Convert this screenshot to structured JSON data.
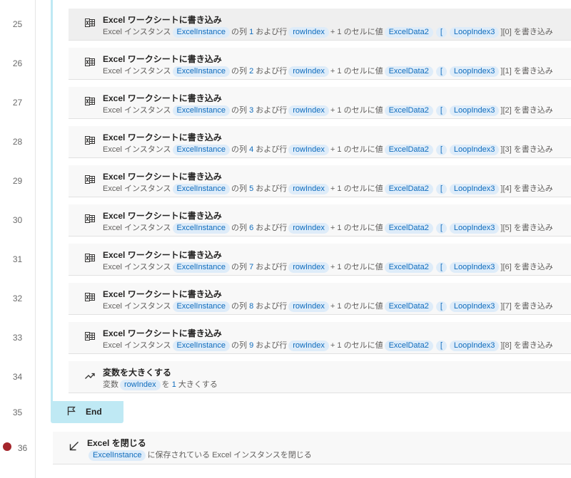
{
  "gutter": {
    "line_numbers": [
      "25",
      "26",
      "27",
      "28",
      "29",
      "30",
      "31",
      "32",
      "33",
      "34",
      "35",
      "36"
    ]
  },
  "actions": [
    {
      "title": "Excel ワークシートに書き込み",
      "p1": "Excel インスタンス",
      "var1": "ExcelInstance",
      "p2": "の列",
      "col": "1",
      "p3": "および行",
      "var2": "rowIndex",
      "p4": "+",
      "one": "1",
      "p5": "のセルに値",
      "var3": "ExcelData2",
      "bo": "[",
      "var4": "LoopIndex3",
      "bc": "][0]",
      "p6": "を書き込み"
    },
    {
      "title": "Excel ワークシートに書き込み",
      "p1": "Excel インスタンス",
      "var1": "ExcelInstance",
      "p2": "の列",
      "col": "2",
      "p3": "および行",
      "var2": "rowIndex",
      "p4": "+",
      "one": "1",
      "p5": "のセルに値",
      "var3": "ExcelData2",
      "bo": "[",
      "var4": "LoopIndex3",
      "bc": "][1]",
      "p6": "を書き込み"
    },
    {
      "title": "Excel ワークシートに書き込み",
      "p1": "Excel インスタンス",
      "var1": "ExcelInstance",
      "p2": "の列",
      "col": "3",
      "p3": "および行",
      "var2": "rowIndex",
      "p4": "+",
      "one": "1",
      "p5": "のセルに値",
      "var3": "ExcelData2",
      "bo": "[",
      "var4": "LoopIndex3",
      "bc": "][2]",
      "p6": "を書き込み"
    },
    {
      "title": "Excel ワークシートに書き込み",
      "p1": "Excel インスタンス",
      "var1": "ExcelInstance",
      "p2": "の列",
      "col": "4",
      "p3": "および行",
      "var2": "rowIndex",
      "p4": "+",
      "one": "1",
      "p5": "のセルに値",
      "var3": "ExcelData2",
      "bo": "[",
      "var4": "LoopIndex3",
      "bc": "][3]",
      "p6": "を書き込み"
    },
    {
      "title": "Excel ワークシートに書き込み",
      "p1": "Excel インスタンス",
      "var1": "ExcelInstance",
      "p2": "の列",
      "col": "5",
      "p3": "および行",
      "var2": "rowIndex",
      "p4": "+",
      "one": "1",
      "p5": "のセルに値",
      "var3": "ExcelData2",
      "bo": "[",
      "var4": "LoopIndex3",
      "bc": "][4]",
      "p6": "を書き込み"
    },
    {
      "title": "Excel ワークシートに書き込み",
      "p1": "Excel インスタンス",
      "var1": "ExcelInstance",
      "p2": "の列",
      "col": "6",
      "p3": "および行",
      "var2": "rowIndex",
      "p4": "+",
      "one": "1",
      "p5": "のセルに値",
      "var3": "ExcelData2",
      "bo": "[",
      "var4": "LoopIndex3",
      "bc": "][5]",
      "p6": "を書き込み"
    },
    {
      "title": "Excel ワークシートに書き込み",
      "p1": "Excel インスタンス",
      "var1": "ExcelInstance",
      "p2": "の列",
      "col": "7",
      "p3": "および行",
      "var2": "rowIndex",
      "p4": "+",
      "one": "1",
      "p5": "のセルに値",
      "var3": "ExcelData2",
      "bo": "[",
      "var4": "LoopIndex3",
      "bc": "][6]",
      "p6": "を書き込み"
    },
    {
      "title": "Excel ワークシートに書き込み",
      "p1": "Excel インスタンス",
      "var1": "ExcelInstance",
      "p2": "の列",
      "col": "8",
      "p3": "および行",
      "var2": "rowIndex",
      "p4": "+",
      "one": "1",
      "p5": "のセルに値",
      "var3": "ExcelData2",
      "bo": "[",
      "var4": "LoopIndex3",
      "bc": "][7]",
      "p6": "を書き込み"
    },
    {
      "title": "Excel ワークシートに書き込み",
      "p1": "Excel インスタンス",
      "var1": "ExcelInstance",
      "p2": "の列",
      "col": "9",
      "p3": "および行",
      "var2": "rowIndex",
      "p4": "+",
      "one": "1",
      "p5": "のセルに値",
      "var3": "ExcelData2",
      "bo": "[",
      "var4": "LoopIndex3",
      "bc": "][8]",
      "p6": "を書き込み"
    }
  ],
  "increase": {
    "title": "変数を大きくする",
    "p1": "変数",
    "var1": "rowIndex",
    "p2": "を",
    "num": "1",
    "p3": "大きくする"
  },
  "end": {
    "label": "End"
  },
  "close": {
    "title": "Excel を閉じる",
    "var1": "ExcelInstance",
    "p1": "に保存されている Excel インスタンスを閉じる"
  },
  "icons": {
    "excel_write": "excel-write-icon",
    "increase": "trend-up-icon",
    "end": "flag-icon",
    "close": "arrow-down-left-icon"
  },
  "colors": {
    "chip_bg": "#deecf9",
    "chip_text": "#0f6cbd",
    "loop_accent": "#bfe9f4",
    "breakpoint": "#a4262c"
  }
}
